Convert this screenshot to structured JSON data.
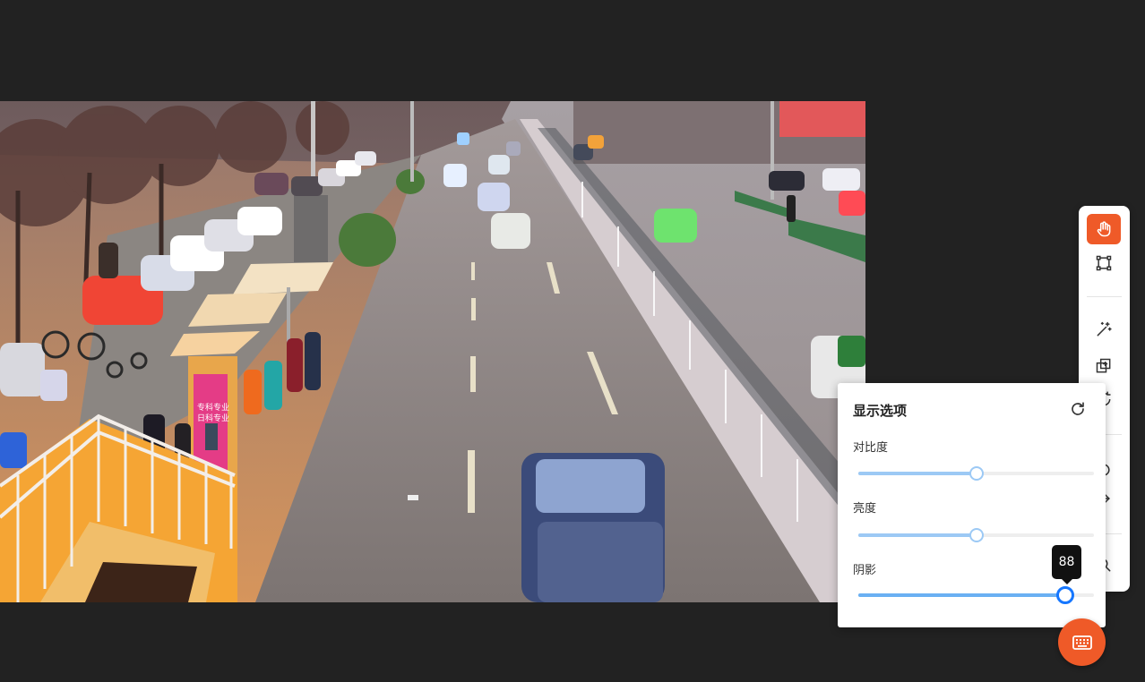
{
  "photo": {
    "subject": "traffic-camera-street-scene",
    "sign_lines": [
      "专科专业",
      "日科专业"
    ]
  },
  "toolbar": {
    "tools": [
      {
        "name": "hand-pan-tool",
        "active": true
      },
      {
        "name": "bounding-box-tool",
        "active": false
      },
      {
        "name": "magic-wand-tool",
        "active": false
      },
      {
        "name": "add-layer-tool",
        "active": false
      },
      {
        "name": "rotate-tool",
        "active": false
      },
      {
        "name": "circle-tool",
        "active": false
      },
      {
        "name": "arrow-tool",
        "active": false
      },
      {
        "name": "search-tool",
        "active": false
      }
    ]
  },
  "display_panel": {
    "title": "显示选项",
    "reset_icon": "refresh-icon",
    "sliders": [
      {
        "label": "对比度",
        "value": 50
      },
      {
        "label": "亮度",
        "value": 50
      },
      {
        "label": "阴影",
        "value": 88
      }
    ],
    "tooltip_value": "88"
  },
  "fab": {
    "icon": "keyboard-icon",
    "color": "#ef5a28"
  },
  "colors": {
    "accent": "#ef5a28",
    "slider_active": "#1677ff",
    "slider_light": "#9cc9f5",
    "background": "#222222"
  }
}
